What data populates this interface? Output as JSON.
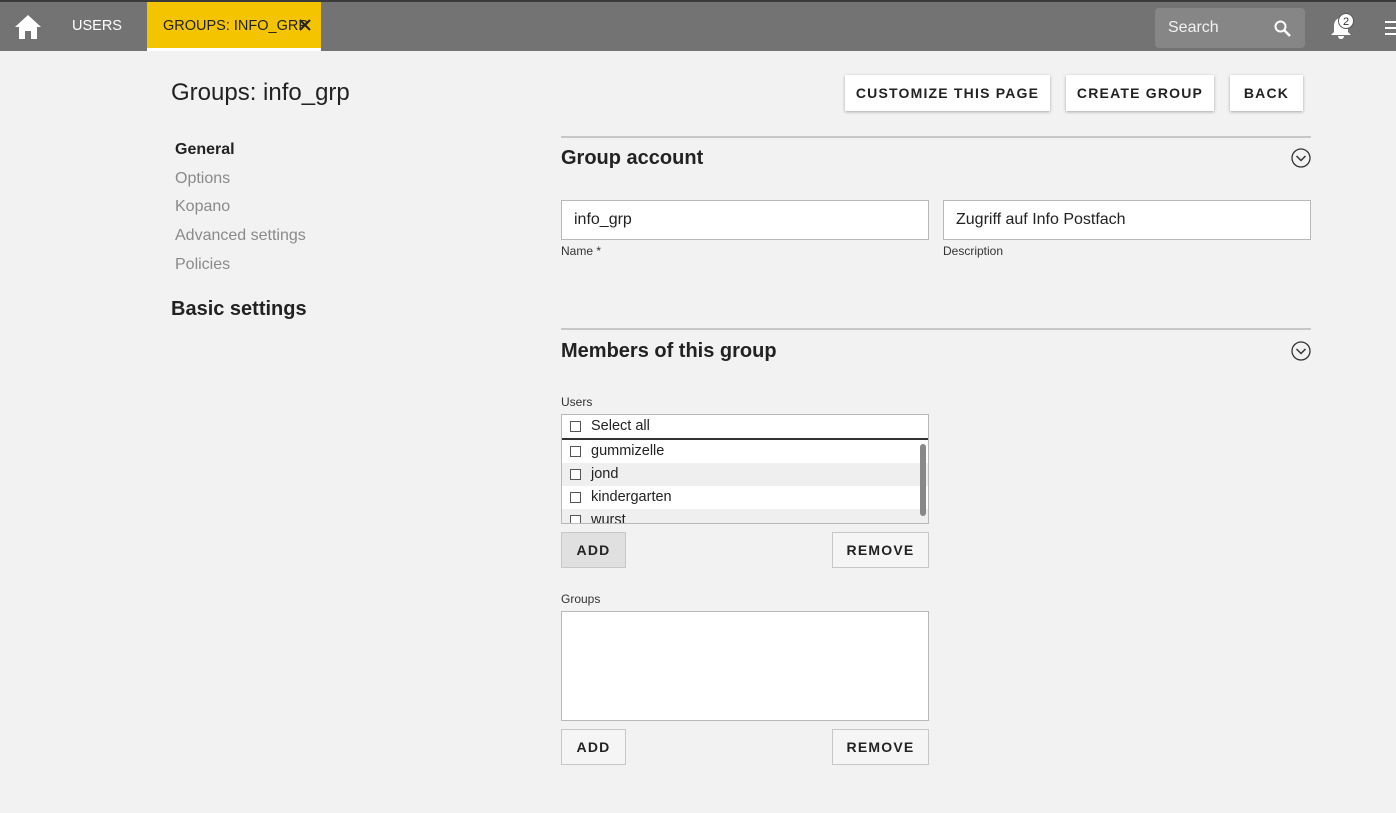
{
  "topbar": {
    "tabs": [
      {
        "label": "USERS"
      },
      {
        "label": "GROUPS: INFO_GRP",
        "active": true
      }
    ],
    "search_placeholder": "Search",
    "notification_count": "2",
    "accent_color": "#f5c400"
  },
  "page": {
    "title": "Groups: info_grp",
    "actions": {
      "customize": "CUSTOMIZE THIS PAGE",
      "create": "CREATE GROUP",
      "back": "BACK"
    }
  },
  "sidebar": {
    "items": [
      {
        "label": "General"
      },
      {
        "label": "Options"
      },
      {
        "label": "Kopano"
      },
      {
        "label": "Advanced settings"
      },
      {
        "label": "Policies"
      }
    ],
    "section_heading": "Basic settings"
  },
  "group_account": {
    "title": "Group account",
    "name_value": "info_grp",
    "name_label": "Name *",
    "description_value": "Zugriff auf Info Postfach",
    "description_label": "Description"
  },
  "members": {
    "title": "Members of this group",
    "users_label": "Users",
    "select_all": "Select all",
    "users": [
      {
        "name": "gummizelle"
      },
      {
        "name": "jond"
      },
      {
        "name": "kindergarten"
      },
      {
        "name": "wurst"
      }
    ],
    "groups_label": "Groups",
    "add_label": "ADD",
    "remove_label": "REMOVE"
  }
}
